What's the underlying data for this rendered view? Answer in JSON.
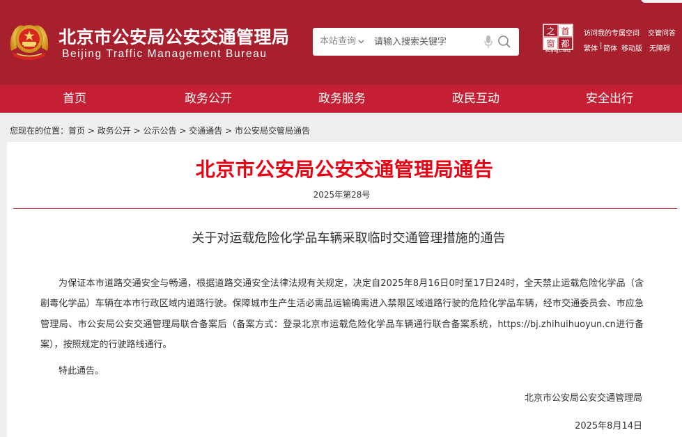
{
  "header": {
    "title_cn": "北京市公安局公安交通管理局",
    "title_en": "Beijing Traffic Management Bureau",
    "search": {
      "scope_label": "本站查询",
      "placeholder": "请输入搜索关键字"
    },
    "capital_logo_text": "Beijing-China",
    "links": {
      "special_zone": "访问我的专属空间",
      "traffic_q": "交管问答",
      "traditional": "繁体",
      "simplified": "简体",
      "mobile": "移动版",
      "accessibility": "无障碍"
    },
    "colors": {
      "header_bg": "#a8202e",
      "nav_bg": "#c41f32",
      "title_red": "#e60012"
    }
  },
  "nav": {
    "items": [
      {
        "label": "首页"
      },
      {
        "label": "政务公开"
      },
      {
        "label": "政务服务"
      },
      {
        "label": "政民互动"
      },
      {
        "label": "安全出行"
      }
    ]
  },
  "breadcrumb": {
    "prefix": "您现在的位置：",
    "items": [
      "首页",
      "政务公开",
      "公示公告",
      "交通通告",
      "市公安局交管局通告"
    ],
    "separator": ">"
  },
  "article": {
    "title": "北京市公安局公安交通管理局通告",
    "number": "2025年第28号",
    "subtitle": "关于对运载危险化学品车辆采取临时交通管理措施的通告",
    "body": "为保证本市道路交通安全与畅通，根据道路交通安全法律法规有关规定，决定自2025年8月16日0时至17日24时，全天禁止运载危险化学品（含剧毒化学品）车辆在本市行政区域内道路行驶。保障城市生产生活必需品运输确需进入禁限区域道路行驶的危险化学品车辆，经市交通委员会、市应急管理局、市公安局公安交通管理局联合备案后（备案方式：登录北京市运载危险化学品车辆通行联合备案系统，https://bj.zhihuihuoyun.cn进行备案），按照规定的行驶路线通行。",
    "closing": "特此通告。",
    "issuer": "北京市公安局公安交通管理局",
    "date": "2025年8月14日"
  }
}
